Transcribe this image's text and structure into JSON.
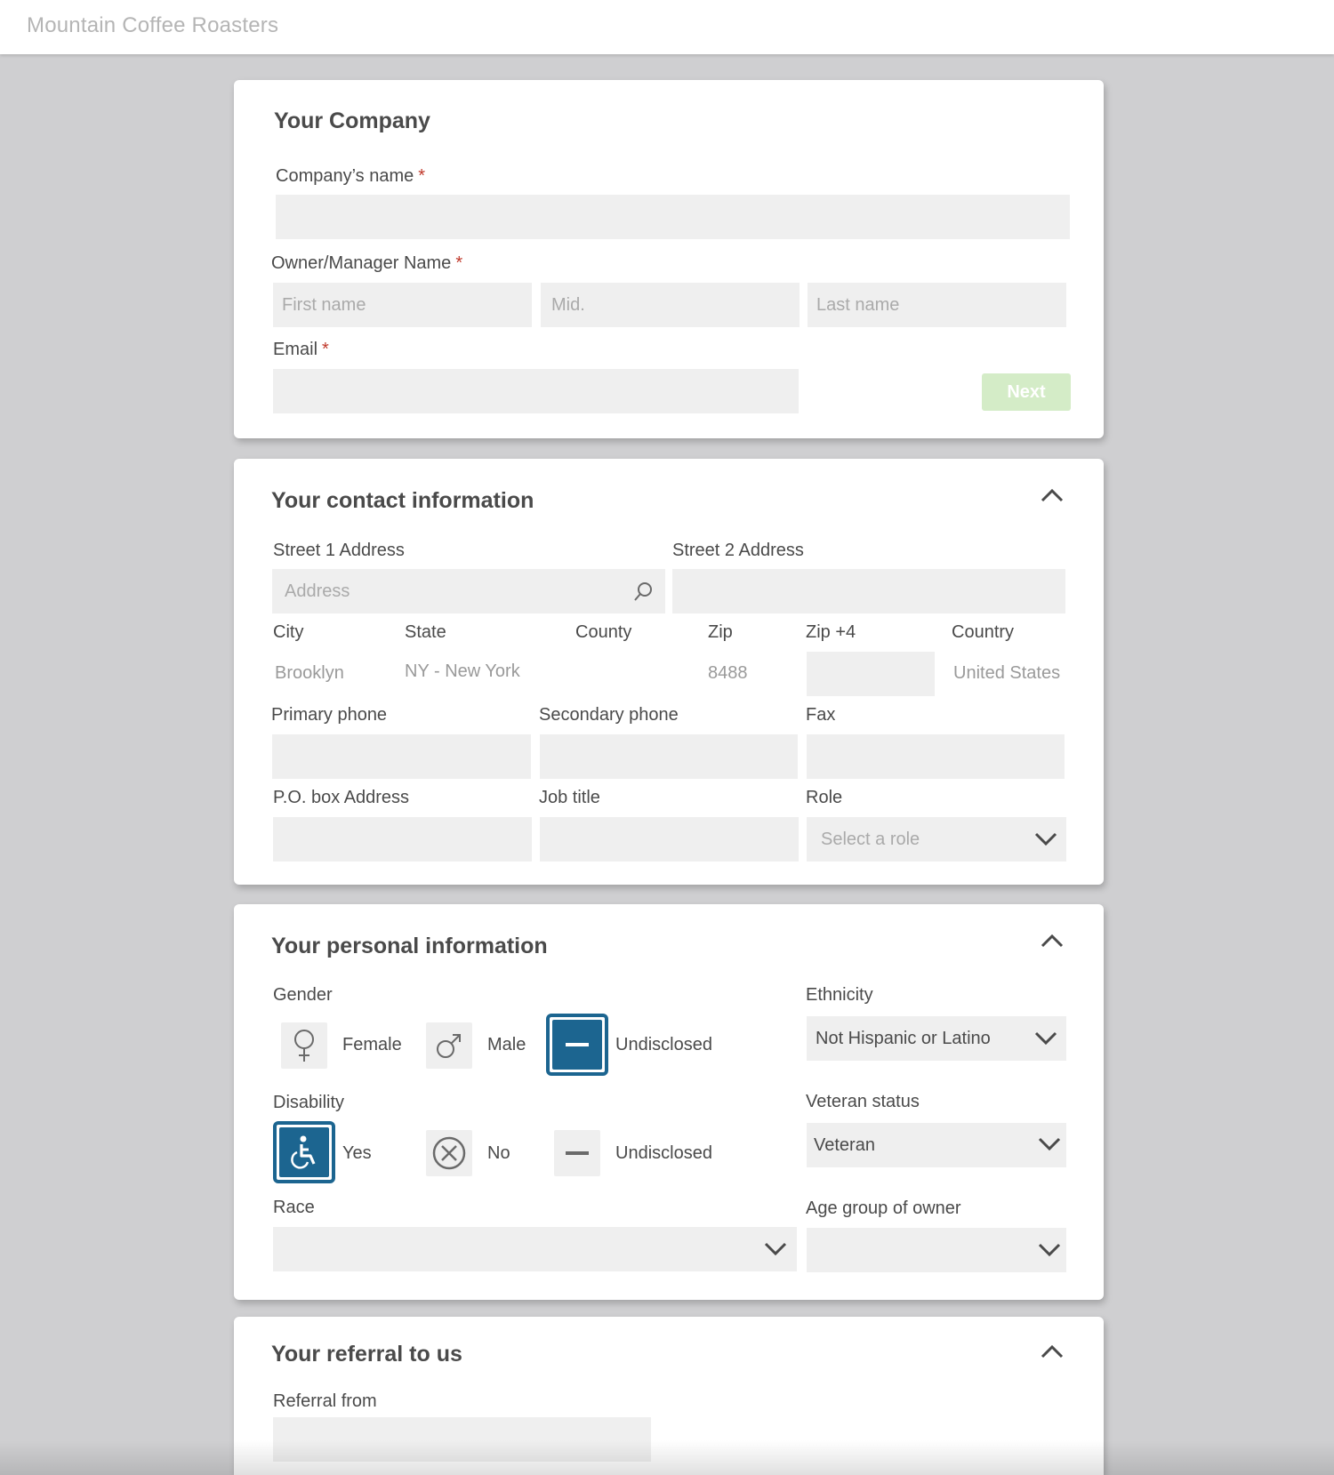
{
  "app": {
    "brand": "Mountain Coffee Roasters"
  },
  "company_section": {
    "title": "Your Company",
    "company_name_label": "Company’s name",
    "company_name_value": "",
    "owner_label": "Owner/Manager Name",
    "first_name_placeholder": "First name",
    "middle_placeholder": "Mid.",
    "last_name_placeholder": "Last name",
    "email_label": "Email",
    "email_value": "",
    "required_mark": "*",
    "next_label": "Next"
  },
  "contact_section": {
    "title": "Your contact information",
    "street1_label": "Street 1 Address",
    "street1_placeholder": "Address",
    "street2_label": "Street 2 Address",
    "city_label": "City",
    "city_value": "Brooklyn",
    "state_label": "State",
    "state_value": "NY - New York",
    "county_label": "County",
    "county_value": "",
    "zip_label": "Zip",
    "zip_value": "8488",
    "zip4_label": "Zip +4",
    "zip4_value": "",
    "country_label": "Country",
    "country_value": "United States",
    "primary_phone_label": "Primary phone",
    "secondary_phone_label": "Secondary phone",
    "fax_label": "Fax",
    "po_box_label": "P.O. box Address",
    "job_title_label": "Job title",
    "role_label": "Role",
    "role_placeholder": "Select a role"
  },
  "personal_section": {
    "title": "Your personal information",
    "gender_label": "Gender",
    "gender_options": [
      {
        "label": "Female",
        "icon": "female-icon",
        "selected": false
      },
      {
        "label": "Male",
        "icon": "male-icon",
        "selected": false
      },
      {
        "label": "Undisclosed",
        "icon": "minus-icon",
        "selected": true
      }
    ],
    "ethnicity_label": "Ethnicity",
    "ethnicity_value": "Not Hispanic or Latino",
    "disability_label": "Disability",
    "disability_options": [
      {
        "label": "Yes",
        "icon": "wheelchair-icon",
        "selected": true
      },
      {
        "label": "No",
        "icon": "x-circle-icon",
        "selected": false
      },
      {
        "label": "Undisclosed",
        "icon": "minus-icon",
        "selected": false
      }
    ],
    "veteran_label": "Veteran status",
    "veteran_value": "Veteran",
    "race_label": "Race",
    "race_value": "",
    "age_group_label": "Age group of owner",
    "age_group_value": ""
  },
  "referral_section": {
    "title": "Your referral to us",
    "referral_from_label": "Referral from",
    "referral_from_value": ""
  },
  "colors": {
    "background": "#cfcfd1",
    "card": "#ffffff",
    "field": "#efefef",
    "accent_blue": "#1c6590",
    "next_button": "#d4ecc7",
    "required": "#c0392b"
  }
}
